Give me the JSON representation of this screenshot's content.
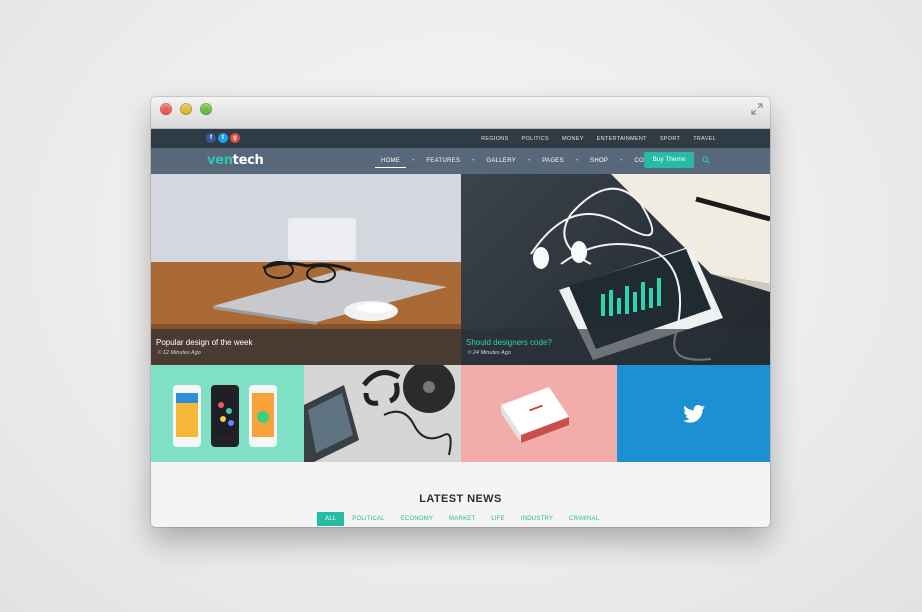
{
  "topbar": {
    "social": [
      {
        "icon": "facebook-icon",
        "glyph": "f",
        "color": "#3b5998"
      },
      {
        "icon": "twitter-icon",
        "glyph": "t",
        "color": "#1da1f2"
      },
      {
        "icon": "google-plus-icon",
        "glyph": "g",
        "color": "#dd4b39"
      }
    ],
    "nav": [
      "REGIONS",
      "POLITICS",
      "MONEY",
      "ENTERTAINMENT",
      "SPORT",
      "TRAVEL"
    ]
  },
  "header": {
    "logo_part1": "ven",
    "logo_part2": "tech",
    "nav": [
      "HOME",
      "FEATURES",
      "GALLERY",
      "PAGES",
      "SHOP",
      "CONTACT"
    ],
    "active_nav": "HOME",
    "buy_label": "Buy Theme",
    "accent": "#26bba5"
  },
  "hero": [
    {
      "title": "Popular design of the week",
      "time": "12 Minutes Ago"
    },
    {
      "title": "Should designers code?",
      "time": "24 Minutes Ago"
    }
  ],
  "tiles": [
    {
      "icon": "mobile-apps-image",
      "color": "#7fe0c5"
    },
    {
      "icon": "laptop-headphones-image",
      "color": "#d9d9d9"
    },
    {
      "icon": "business-cards-image",
      "color": "#f0aaa7"
    },
    {
      "icon": "twitter-icon",
      "color": "#1b91d3"
    }
  ],
  "latest": {
    "heading": "LATEST NEWS",
    "filters": [
      "ALL",
      "POLITICAL",
      "ECONOMY",
      "MARKET",
      "LIFE",
      "INDUSTRY",
      "CRIMINAL"
    ],
    "active_filter": "ALL"
  }
}
